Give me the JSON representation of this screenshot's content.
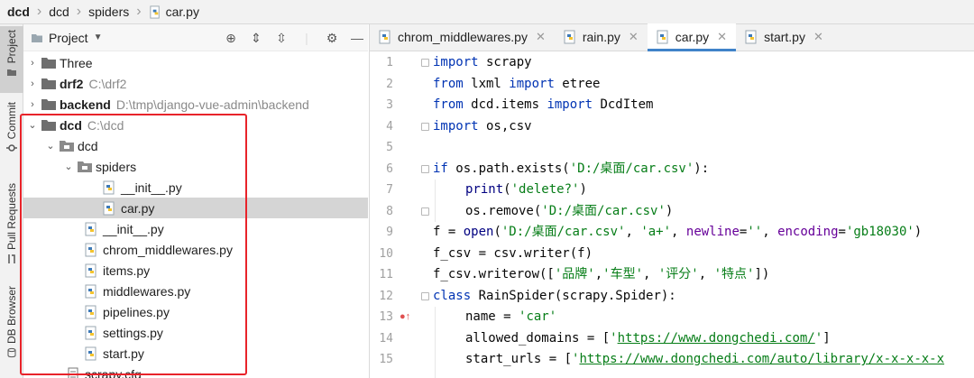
{
  "breadcrumb": {
    "items": [
      "dcd",
      "dcd",
      "spiders",
      "car.py"
    ]
  },
  "toolstrip": {
    "project": "Project",
    "commit": "Commit",
    "pull_requests": "Pull Requests",
    "db_browser": "DB Browser"
  },
  "project_panel": {
    "title": "Project",
    "tree": [
      {
        "name": "Three",
        "path": ""
      },
      {
        "name": "drf2",
        "path": "C:\\drf2"
      },
      {
        "name": "backend",
        "path": "D:\\tmp\\django-vue-admin\\backend"
      },
      {
        "name": "dcd",
        "path": "C:\\dcd"
      },
      {
        "name": "dcd",
        "path": ""
      },
      {
        "name": "spiders",
        "path": ""
      },
      {
        "name": "__init__.py",
        "path": ""
      },
      {
        "name": "car.py",
        "path": ""
      },
      {
        "name": "__init__.py",
        "path": ""
      },
      {
        "name": "chrom_middlewares.py",
        "path": ""
      },
      {
        "name": "items.py",
        "path": ""
      },
      {
        "name": "middlewares.py",
        "path": ""
      },
      {
        "name": "pipelines.py",
        "path": ""
      },
      {
        "name": "settings.py",
        "path": ""
      },
      {
        "name": "start.py",
        "path": ""
      },
      {
        "name": "scrapy.cfg",
        "path": ""
      }
    ]
  },
  "editor": {
    "tabs": [
      {
        "label": "chrom_middlewares.py"
      },
      {
        "label": "rain.py"
      },
      {
        "label": "car.py"
      },
      {
        "label": "start.py"
      }
    ],
    "line_numbers": [
      "1",
      "2",
      "3",
      "4",
      "5",
      "6",
      "7",
      "8",
      "9",
      "10",
      "11",
      "12",
      "13",
      "14",
      "15"
    ],
    "code": {
      "l1": {
        "k": "import",
        "t": " scrapy"
      },
      "l2": {
        "k1": "from",
        "t1": " lxml ",
        "k2": "import",
        "t2": " etree"
      },
      "l3": {
        "k1": "from",
        "t1": " dcd.items ",
        "k2": "import",
        "t2": " DcdItem"
      },
      "l4": {
        "k": "import",
        "t": " os,csv"
      },
      "l6": {
        "k": "if",
        "t1": " os.path.exists(",
        "s": "'D:/桌面/car.csv'",
        "t2": "):"
      },
      "l7": {
        "f": "print",
        "t1": "(",
        "s": "'delete?'",
        "t2": ")"
      },
      "l8": {
        "t1": "os.remove(",
        "s": "'D:/桌面/car.csv'",
        "t2": ")"
      },
      "l9": {
        "t1": "f = ",
        "f": "open",
        "t2": "(",
        "s1": "'D:/桌面/car.csv'",
        "t3": ", ",
        "s2": "'a+'",
        "t4": ", ",
        "a1": "newline",
        "t5": "=",
        "s3": "''",
        "t6": ", ",
        "a2": "encoding",
        "t7": "=",
        "s4": "'gb18030'",
        "t8": ")"
      },
      "l10": {
        "t": "f_csv = csv.writer(f)"
      },
      "l11": {
        "t1": "f_csv.writerow([",
        "s1": "'品牌'",
        "t2": ",",
        "s2": "'车型'",
        "t3": ", ",
        "s3": "'评分'",
        "t4": ", ",
        "s4": "'特点'",
        "t5": "])"
      },
      "l12": {
        "k": "class",
        "t": " RainSpider(scrapy.Spider):"
      },
      "l13": {
        "t1": "name = ",
        "s": "'car'"
      },
      "l14": {
        "t1": "allowed_domains = [",
        "q1": "'",
        "u": "https://www.dongchedi.com/",
        "q2": "'",
        "t2": "]"
      },
      "l15": {
        "t1": "start_urls = [",
        "q1": "'",
        "u": "https://www.dongchedi.com/auto/library/x-x-x-x-x"
      }
    }
  },
  "colors": {
    "keyword": "#0033b3",
    "string": "#067d17",
    "highlight_box": "#e8232a",
    "active_tab_underline": "#4083c9"
  }
}
